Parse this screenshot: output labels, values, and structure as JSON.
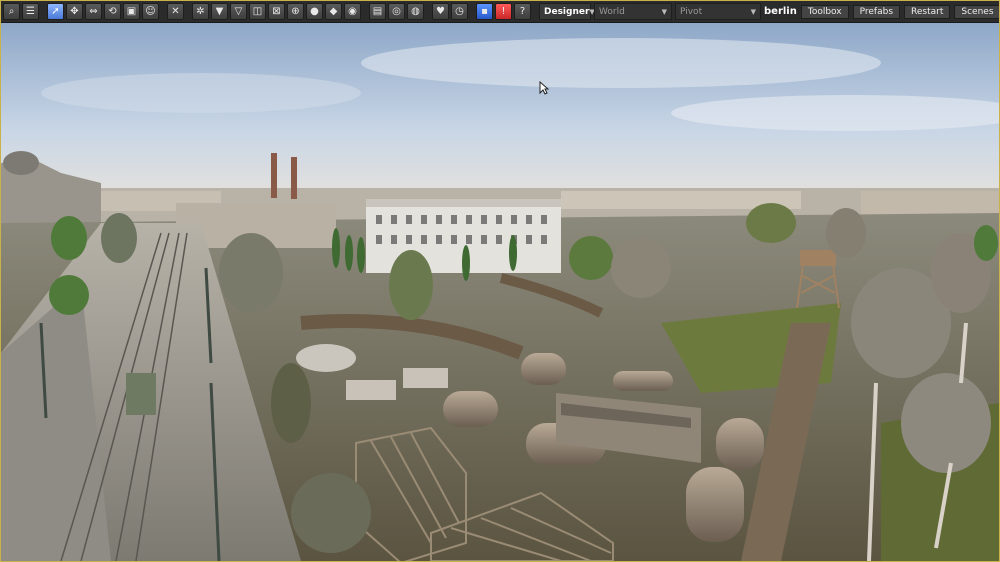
{
  "toolbar": {
    "mode_dropdown": "Designer",
    "space_dropdown": "World",
    "pivot_dropdown": "Pivot",
    "level_name": "berlin",
    "tabs": [
      "Toolbox",
      "Prefabs",
      "Restart",
      "Scenes"
    ],
    "help_glyph": "?",
    "warning_glyph": "!"
  },
  "colors": {
    "toolbar_bg": "#2b2b2b",
    "active_blue": "#4a79d8",
    "warning_red": "#c92828",
    "frame_border": "#c9b24a"
  }
}
